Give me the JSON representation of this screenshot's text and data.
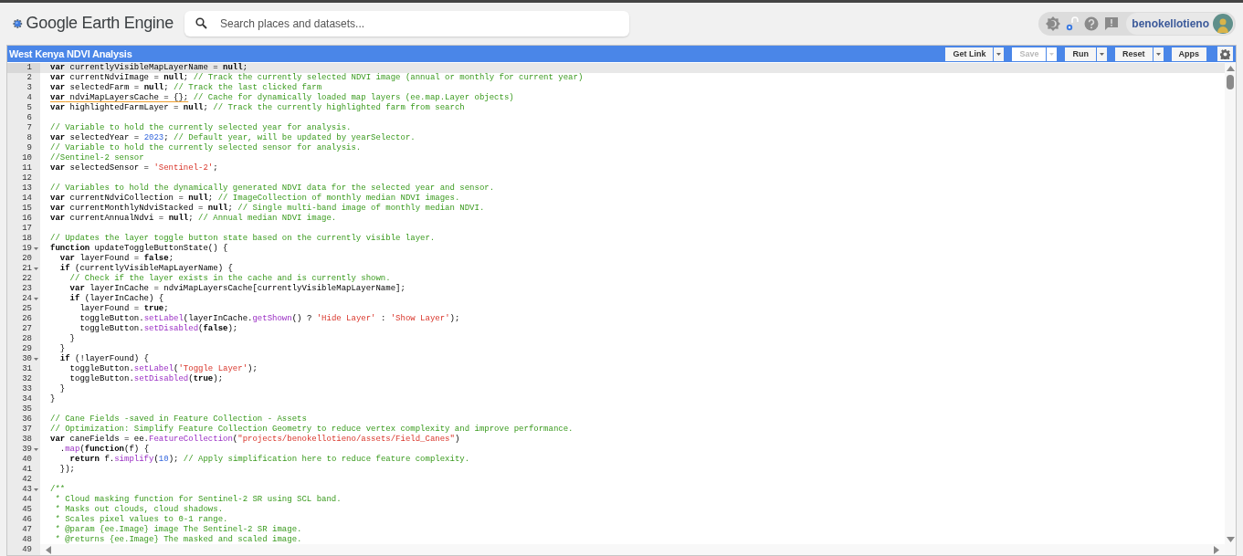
{
  "header": {
    "app_title": "Google Earth Engine",
    "search": {
      "placeholder": "Search places and datasets..."
    },
    "user": {
      "name": "benokellotieno"
    }
  },
  "script": {
    "title": "West Kenya NDVI Analysis",
    "buttons": [
      {
        "label": "Get Link",
        "disabled": false,
        "has_menu": true
      },
      {
        "label": "Save",
        "disabled": true,
        "has_menu": true
      },
      {
        "label": "Run",
        "disabled": false,
        "has_menu": true
      },
      {
        "label": "Reset",
        "disabled": false,
        "has_menu": true
      },
      {
        "label": "Apps",
        "disabled": false,
        "has_menu": false
      }
    ]
  },
  "editor": {
    "lines": [
      {
        "number": "1",
        "fold": false,
        "active": true,
        "code": [
          {
            "kind": "keyword",
            "text": "var"
          },
          {
            "kind": "plain",
            "text": " currentlyVisibleMapLayerName = "
          },
          {
            "kind": "keyword",
            "text": "null"
          },
          {
            "kind": "plain",
            "text": ";"
          }
        ]
      },
      {
        "number": "2",
        "fold": false,
        "active": false,
        "code": [
          {
            "kind": "keyword",
            "text": "var"
          },
          {
            "kind": "plain",
            "text": " currentNdviImage = "
          },
          {
            "kind": "keyword",
            "text": "null"
          },
          {
            "kind": "plain",
            "text": ";"
          },
          {
            "kind": "comment",
            "text": " // Track the currently selected NDVI image (annual or monthly for current year)"
          }
        ]
      },
      {
        "number": "3",
        "fold": false,
        "active": false,
        "code": [
          {
            "kind": "keyword",
            "text": "var"
          },
          {
            "kind": "plain",
            "text": " selectedFarm = "
          },
          {
            "kind": "keyword",
            "text": "null"
          },
          {
            "kind": "plain",
            "text": ";"
          },
          {
            "kind": "comment",
            "text": " // Track the last clicked farm"
          }
        ]
      },
      {
        "number": "4",
        "fold": false,
        "active": false,
        "code": [
          {
            "kind": "keyword_flagged",
            "text": "var"
          },
          {
            "kind": "plain_flagged",
            "text": " ndviMapLayersCache = {};"
          },
          {
            "kind": "comment",
            "text": " // Cache for dynamically loaded map layers (ee.map.Layer objects)"
          }
        ]
      },
      {
        "number": "5",
        "fold": false,
        "active": false,
        "code": [
          {
            "kind": "keyword",
            "text": "var"
          },
          {
            "kind": "plain",
            "text": " highlightedFarmLayer = "
          },
          {
            "kind": "keyword",
            "text": "null"
          },
          {
            "kind": "plain",
            "text": ";"
          },
          {
            "kind": "comment",
            "text": " // Track the currently highlighted farm from search"
          }
        ]
      },
      {
        "number": "6",
        "fold": false,
        "active": false
      },
      {
        "number": "7",
        "fold": false,
        "active": false,
        "code": [
          {
            "kind": "comment",
            "text": "// Variable to hold the currently selected year for analysis."
          }
        ]
      },
      {
        "number": "8",
        "fold": false,
        "active": false,
        "code": [
          {
            "kind": "keyword",
            "text": "var"
          },
          {
            "kind": "plain",
            "text": " selectedYear = "
          },
          {
            "kind": "number",
            "text": "2023"
          },
          {
            "kind": "plain",
            "text": ";"
          },
          {
            "kind": "comment",
            "text": " // Default year, will be updated by yearSelector."
          }
        ]
      },
      {
        "number": "9",
        "fold": false,
        "active": false,
        "code": [
          {
            "kind": "comment",
            "text": "// Variable to hold the currently selected sensor for analysis."
          }
        ]
      },
      {
        "number": "10",
        "fold": false,
        "active": false,
        "code": [
          {
            "kind": "comment",
            "text": "//Sentinel-2 sensor"
          }
        ]
      },
      {
        "number": "11",
        "fold": false,
        "active": false,
        "code": [
          {
            "kind": "keyword",
            "text": "var"
          },
          {
            "kind": "plain",
            "text": " selectedSensor = "
          },
          {
            "kind": "string",
            "text": "'Sentinel-2'"
          },
          {
            "kind": "plain",
            "text": ";"
          }
        ]
      },
      {
        "number": "12",
        "fold": false,
        "active": false
      },
      {
        "number": "13",
        "fold": false,
        "active": false,
        "code": [
          {
            "kind": "comment",
            "text": "// Variables to hold the dynamically generated NDVI data for the selected year and sensor."
          }
        ]
      },
      {
        "number": "14",
        "fold": false,
        "active": false,
        "code": [
          {
            "kind": "keyword",
            "text": "var"
          },
          {
            "kind": "plain",
            "text": " currentNdviCollection = "
          },
          {
            "kind": "keyword",
            "text": "null"
          },
          {
            "kind": "plain",
            "text": ";"
          },
          {
            "kind": "comment",
            "text": " // ImageCollection of monthly median NDVI images."
          }
        ]
      },
      {
        "number": "15",
        "fold": false,
        "active": false,
        "code": [
          {
            "kind": "keyword",
            "text": "var"
          },
          {
            "kind": "plain",
            "text": " currentMonthlyNdviStacked = "
          },
          {
            "kind": "keyword",
            "text": "null"
          },
          {
            "kind": "plain",
            "text": ";"
          },
          {
            "kind": "comment",
            "text": " // Single multi-band image of monthly median NDVI."
          }
        ]
      },
      {
        "number": "16",
        "fold": false,
        "active": false,
        "code": [
          {
            "kind": "keyword",
            "text": "var"
          },
          {
            "kind": "plain",
            "text": " currentAnnualNdvi = "
          },
          {
            "kind": "keyword",
            "text": "null"
          },
          {
            "kind": "plain",
            "text": ";"
          },
          {
            "kind": "comment",
            "text": " // Annual median NDVI image."
          }
        ]
      },
      {
        "number": "17",
        "fold": false,
        "active": false
      },
      {
        "number": "18",
        "fold": false,
        "active": false,
        "code": [
          {
            "kind": "comment",
            "text": "// Updates the layer toggle button state based on the currently visible layer."
          }
        ]
      },
      {
        "number": "19",
        "fold": true,
        "active": false,
        "code": [
          {
            "kind": "keyword",
            "text": "function"
          },
          {
            "kind": "plain",
            "text": " updateToggleButtonState() {"
          }
        ]
      },
      {
        "number": "20",
        "fold": false,
        "active": false,
        "code": [
          {
            "kind": "keyword",
            "text": "  var"
          },
          {
            "kind": "plain",
            "text": " layerFound = "
          },
          {
            "kind": "keyword",
            "text": "false"
          },
          {
            "kind": "plain",
            "text": ";"
          }
        ]
      },
      {
        "number": "21",
        "fold": true,
        "active": false,
        "code": [
          {
            "kind": "keyword",
            "text": "  if"
          },
          {
            "kind": "plain",
            "text": " (currentlyVisibleMapLayerName) {"
          }
        ]
      },
      {
        "number": "22",
        "fold": false,
        "active": false,
        "code": [
          {
            "kind": "comment",
            "text": "    // Check if the layer exists in the cache and is currently shown."
          }
        ]
      },
      {
        "number": "23",
        "fold": false,
        "active": false,
        "code": [
          {
            "kind": "keyword",
            "text": "    var"
          },
          {
            "kind": "plain",
            "text": " layerInCache = ndviMapLayersCache[currentlyVisibleMapLayerName];"
          }
        ]
      },
      {
        "number": "24",
        "fold": true,
        "active": false,
        "code": [
          {
            "kind": "keyword",
            "text": "    if"
          },
          {
            "kind": "plain",
            "text": " (layerInCache) {"
          }
        ]
      },
      {
        "number": "25",
        "fold": false,
        "active": false,
        "code": [
          {
            "kind": "plain",
            "text": "      layerFound = "
          },
          {
            "kind": "keyword",
            "text": "true"
          },
          {
            "kind": "plain",
            "text": ";"
          }
        ]
      },
      {
        "number": "26",
        "fold": false,
        "active": false,
        "code": [
          {
            "kind": "plain",
            "text": "      toggleButton."
          },
          {
            "kind": "method",
            "text": "setLabel"
          },
          {
            "kind": "plain",
            "text": "(layerInCache."
          },
          {
            "kind": "method",
            "text": "getShown"
          },
          {
            "kind": "plain",
            "text": "() ? "
          },
          {
            "kind": "string",
            "text": "'Hide Layer'"
          },
          {
            "kind": "plain",
            "text": " : "
          },
          {
            "kind": "string",
            "text": "'Show Layer'"
          },
          {
            "kind": "plain",
            "text": ");"
          }
        ]
      },
      {
        "number": "27",
        "fold": false,
        "active": false,
        "code": [
          {
            "kind": "plain",
            "text": "      toggleButton."
          },
          {
            "kind": "method",
            "text": "setDisabled"
          },
          {
            "kind": "plain",
            "text": "("
          },
          {
            "kind": "keyword",
            "text": "false"
          },
          {
            "kind": "plain",
            "text": ");"
          }
        ]
      },
      {
        "number": "28",
        "fold": false,
        "active": false,
        "code": [
          {
            "kind": "plain",
            "text": "    }"
          }
        ]
      },
      {
        "number": "29",
        "fold": false,
        "active": false,
        "code": [
          {
            "kind": "plain",
            "text": "  }"
          }
        ]
      },
      {
        "number": "30",
        "fold": true,
        "active": false,
        "code": [
          {
            "kind": "keyword",
            "text": "  if"
          },
          {
            "kind": "plain",
            "text": " (!layerFound) {"
          }
        ]
      },
      {
        "number": "31",
        "fold": false,
        "active": false,
        "code": [
          {
            "kind": "plain",
            "text": "    toggleButton."
          },
          {
            "kind": "method",
            "text": "setLabel"
          },
          {
            "kind": "plain",
            "text": "("
          },
          {
            "kind": "string",
            "text": "'Toggle Layer'"
          },
          {
            "kind": "plain",
            "text": ");"
          }
        ]
      },
      {
        "number": "32",
        "fold": false,
        "active": false,
        "code": [
          {
            "kind": "plain",
            "text": "    toggleButton."
          },
          {
            "kind": "method",
            "text": "setDisabled"
          },
          {
            "kind": "plain",
            "text": "("
          },
          {
            "kind": "keyword",
            "text": "true"
          },
          {
            "kind": "plain",
            "text": ");"
          }
        ]
      },
      {
        "number": "33",
        "fold": false,
        "active": false,
        "code": [
          {
            "kind": "plain",
            "text": "  }"
          }
        ]
      },
      {
        "number": "34",
        "fold": false,
        "active": false,
        "code": [
          {
            "kind": "plain",
            "text": "}"
          }
        ]
      },
      {
        "number": "35",
        "fold": false,
        "active": false
      },
      {
        "number": "36",
        "fold": false,
        "active": false,
        "code": [
          {
            "kind": "comment",
            "text": "// Cane Fields -saved in Feature Collection - Assets"
          }
        ]
      },
      {
        "number": "37",
        "fold": false,
        "active": false,
        "code": [
          {
            "kind": "comment",
            "text": "// Optimization: Simplify Feature Collection Geometry to reduce vertex complexity and improve performance."
          }
        ]
      },
      {
        "number": "38",
        "fold": false,
        "active": false,
        "code": [
          {
            "kind": "keyword",
            "text": "var"
          },
          {
            "kind": "plain",
            "text": " caneFields = ee."
          },
          {
            "kind": "method",
            "text": "FeatureCollection"
          },
          {
            "kind": "plain",
            "text": "("
          },
          {
            "kind": "string",
            "text": "\"projects/benokellotieno/assets/Field_Canes\""
          },
          {
            "kind": "plain",
            "text": ")"
          }
        ]
      },
      {
        "number": "39",
        "fold": true,
        "active": false,
        "code": [
          {
            "kind": "plain",
            "text": "  ."
          },
          {
            "kind": "method",
            "text": "map"
          },
          {
            "kind": "plain",
            "text": "("
          },
          {
            "kind": "keyword",
            "text": "function"
          },
          {
            "kind": "plain",
            "text": "(f) {"
          }
        ]
      },
      {
        "number": "40",
        "fold": false,
        "active": false,
        "code": [
          {
            "kind": "keyword",
            "text": "    return"
          },
          {
            "kind": "plain",
            "text": " f."
          },
          {
            "kind": "method",
            "text": "simplify"
          },
          {
            "kind": "plain",
            "text": "("
          },
          {
            "kind": "number",
            "text": "10"
          },
          {
            "kind": "plain",
            "text": ");"
          },
          {
            "kind": "comment",
            "text": " // Apply simplification here to reduce feature complexity."
          }
        ]
      },
      {
        "number": "41",
        "fold": false,
        "active": false,
        "code": [
          {
            "kind": "plain",
            "text": "  });"
          }
        ]
      },
      {
        "number": "42",
        "fold": false,
        "active": false
      },
      {
        "number": "43",
        "fold": true,
        "active": false,
        "code": [
          {
            "kind": "comment",
            "text": "/**"
          }
        ]
      },
      {
        "number": "44",
        "fold": false,
        "active": false,
        "code": [
          {
            "kind": "comment",
            "text": " * Cloud masking function for Sentinel-2 SR using SCL band."
          }
        ]
      },
      {
        "number": "45",
        "fold": false,
        "active": false,
        "code": [
          {
            "kind": "comment",
            "text": " * Masks out clouds, cloud shadows."
          }
        ]
      },
      {
        "number": "46",
        "fold": false,
        "active": false,
        "code": [
          {
            "kind": "comment",
            "text": " * Scales pixel values to 0-1 range."
          }
        ]
      },
      {
        "number": "47",
        "fold": false,
        "active": false,
        "code": [
          {
            "kind": "comment",
            "text": " * @param {ee.Image} image The Sentinel-2 SR image."
          }
        ]
      },
      {
        "number": "48",
        "fold": false,
        "active": false,
        "code": [
          {
            "kind": "comment",
            "text": " * @returns {ee.Image} The masked and scaled image."
          }
        ]
      },
      {
        "number": "49",
        "fold": false,
        "active": false
      }
    ]
  }
}
